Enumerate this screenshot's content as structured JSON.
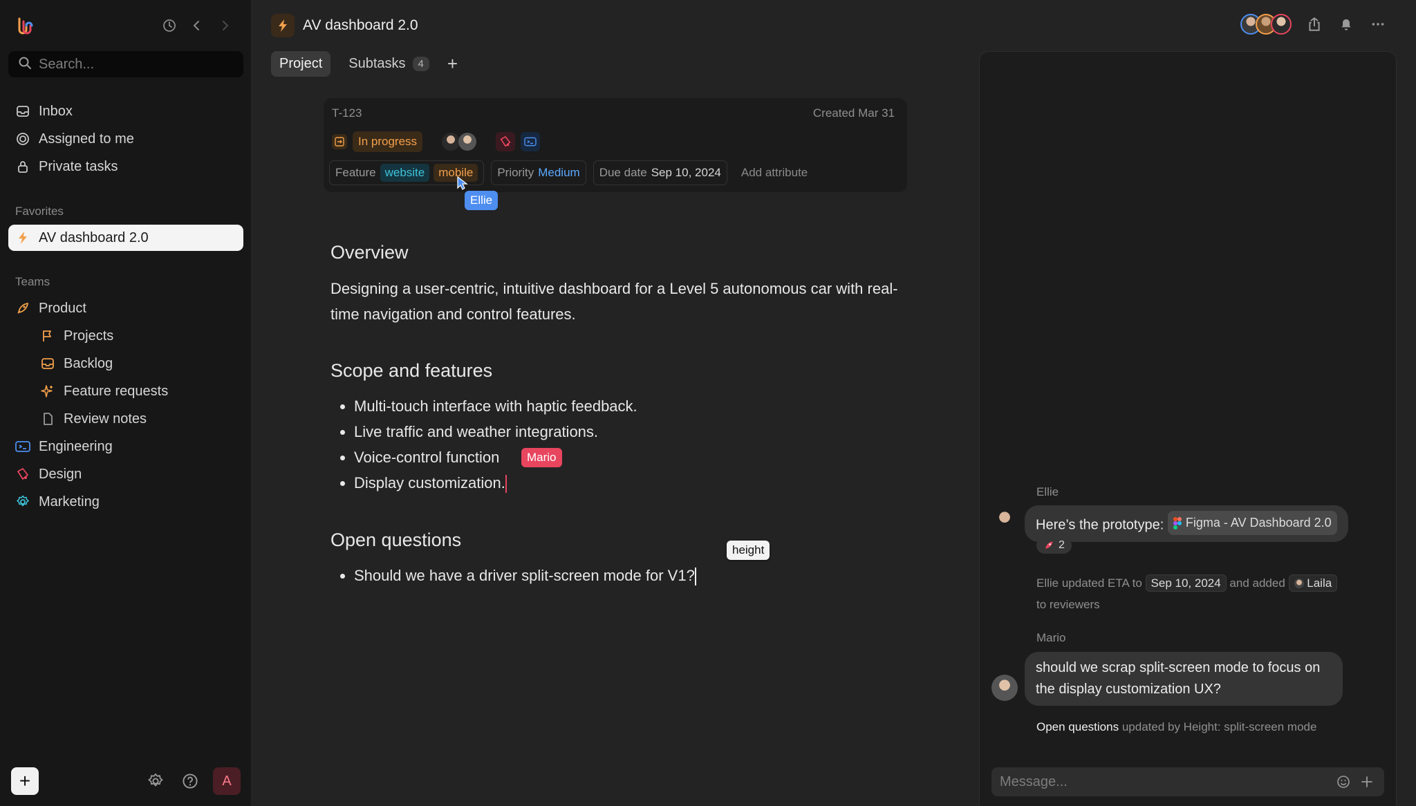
{
  "sidebar": {
    "search_placeholder": "Search...",
    "nav": [
      {
        "label": "Inbox",
        "icon": "inbox-icon"
      },
      {
        "label": "Assigned to me",
        "icon": "target-icon"
      },
      {
        "label": "Private tasks",
        "icon": "lock-icon"
      }
    ],
    "favorites_label": "Favorites",
    "favorite_item": "AV dashboard 2.0",
    "teams_label": "Teams",
    "teams": [
      {
        "label": "Product",
        "icon": "rocket-icon",
        "color": "#f2a04b"
      },
      {
        "label": "Projects",
        "icon": "flag-icon",
        "color": "#f2a04b"
      },
      {
        "label": "Backlog",
        "icon": "inbox-icon",
        "color": "#f2a04b"
      },
      {
        "label": "Feature requests",
        "icon": "sparkle-icon",
        "color": "#f2a04b"
      },
      {
        "label": "Review notes",
        "icon": "document-icon",
        "color": "#9a9a9a"
      },
      {
        "label": "Engineering",
        "icon": "terminal-icon",
        "color": "#4d8ef0"
      },
      {
        "label": "Design",
        "icon": "palette-icon",
        "color": "#e8455e"
      },
      {
        "label": "Marketing",
        "icon": "gear-icon",
        "color": "#3ec1d9"
      }
    ],
    "user_initial": "A"
  },
  "header": {
    "title": "AV dashboard 2.0"
  },
  "tabs": [
    {
      "label": "Project"
    },
    {
      "label": "Subtasks",
      "count": "4"
    }
  ],
  "task": {
    "id": "T-123",
    "created": "Created Mar 31",
    "status": "In progress",
    "feature_label": "Feature",
    "feature_tags": [
      "website",
      "mobile"
    ],
    "priority_label": "Priority",
    "priority_value": "Medium",
    "due_label": "Due date",
    "due_value": "Sep 10, 2024",
    "add_attribute": "Add attribute"
  },
  "cursors": {
    "ellie": "Ellie",
    "mario": "Mario",
    "height": "height"
  },
  "doc": {
    "overview_title": "Overview",
    "overview_text": "Designing a user-centric, intuitive dashboard for a Level 5 autonomous car with real-time navigation and control features.",
    "scope_title": "Scope and features",
    "scope_items": [
      "Multi-touch interface with haptic feedback.",
      "Live traffic and weather integrations.",
      "Voice-control function",
      "Display customization."
    ],
    "questions_title": "Open questions",
    "question_items": [
      "Should we have a driver split-screen mode for V1?"
    ]
  },
  "chat": {
    "msg1_sender": "Ellie",
    "msg1_text": "Here’s the prototype:",
    "msg1_link": "Figma - AV Dashboard 2.0",
    "msg1_reaction_count": "2",
    "activity1_prefix": "Ellie updated ETA to",
    "activity1_date": "Sep 10, 2024",
    "activity1_mid": "and added",
    "activity1_person": "Laila",
    "activity1_suffix": "to reviewers",
    "msg2_sender": "Mario",
    "msg2_text": "should we scrap split-screen mode to focus on the display customization UX?",
    "activity2_strong": "Open questions",
    "activity2_rest": "updated by Height: split-screen mode",
    "input_placeholder": "Message..."
  },
  "colors": {
    "accent_orange": "#f2a04b",
    "accent_blue": "#4d8ef0",
    "accent_pink": "#e8455e",
    "accent_cyan": "#3ec1d9"
  }
}
